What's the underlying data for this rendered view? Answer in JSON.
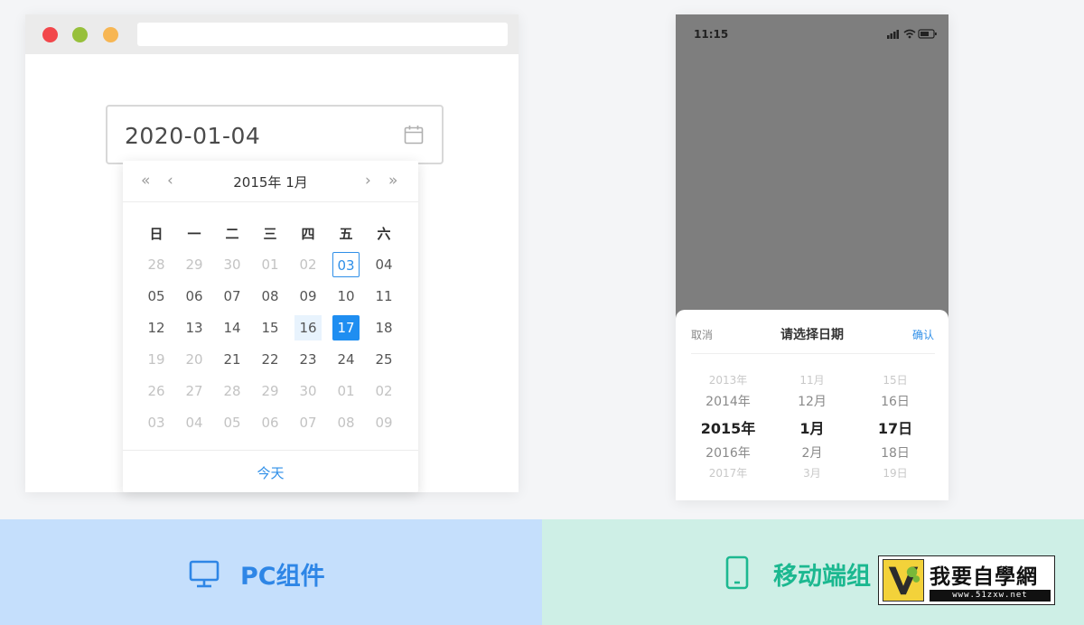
{
  "pc": {
    "date_input_value": "2020-01-04",
    "calendar": {
      "title": "2015年 1月",
      "nav": {
        "prev_year": "«",
        "prev_month": "‹",
        "next_month": "›",
        "next_year": "»"
      },
      "weekdays": [
        "日",
        "一",
        "二",
        "三",
        "四",
        "五",
        "六"
      ],
      "weeks": [
        [
          {
            "d": "28",
            "s": "muted"
          },
          {
            "d": "29",
            "s": "muted"
          },
          {
            "d": "30",
            "s": "muted"
          },
          {
            "d": "01",
            "s": "muted"
          },
          {
            "d": "02",
            "s": "muted"
          },
          {
            "d": "03",
            "s": "today"
          },
          {
            "d": "04",
            "s": ""
          }
        ],
        [
          {
            "d": "05",
            "s": ""
          },
          {
            "d": "06",
            "s": ""
          },
          {
            "d": "07",
            "s": ""
          },
          {
            "d": "08",
            "s": ""
          },
          {
            "d": "09",
            "s": ""
          },
          {
            "d": "10",
            "s": ""
          },
          {
            "d": "11",
            "s": ""
          }
        ],
        [
          {
            "d": "12",
            "s": ""
          },
          {
            "d": "13",
            "s": ""
          },
          {
            "d": "14",
            "s": ""
          },
          {
            "d": "15",
            "s": ""
          },
          {
            "d": "16",
            "s": "range"
          },
          {
            "d": "17",
            "s": "selected"
          },
          {
            "d": "18",
            "s": ""
          }
        ],
        [
          {
            "d": "19",
            "s": "muted"
          },
          {
            "d": "20",
            "s": "muted"
          },
          {
            "d": "21",
            "s": ""
          },
          {
            "d": "22",
            "s": ""
          },
          {
            "d": "23",
            "s": ""
          },
          {
            "d": "24",
            "s": ""
          },
          {
            "d": "25",
            "s": ""
          }
        ],
        [
          {
            "d": "26",
            "s": "muted"
          },
          {
            "d": "27",
            "s": "muted"
          },
          {
            "d": "28",
            "s": "muted"
          },
          {
            "d": "29",
            "s": "muted"
          },
          {
            "d": "30",
            "s": "muted"
          },
          {
            "d": "01",
            "s": "muted"
          },
          {
            "d": "02",
            "s": "muted"
          }
        ],
        [
          {
            "d": "03",
            "s": "muted"
          },
          {
            "d": "04",
            "s": "muted"
          },
          {
            "d": "05",
            "s": "muted"
          },
          {
            "d": "06",
            "s": "muted"
          },
          {
            "d": "07",
            "s": "muted"
          },
          {
            "d": "08",
            "s": "muted"
          },
          {
            "d": "09",
            "s": "muted"
          }
        ]
      ],
      "today_label": "今天"
    }
  },
  "mobile": {
    "status_time": "11:15",
    "status_icons": [
      "signal-icon",
      "wifi-icon",
      "battery-icon"
    ],
    "sheet": {
      "cancel": "取消",
      "title": "请选择日期",
      "confirm": "确认",
      "years": [
        "2013年",
        "2014年",
        "2015年",
        "2016年",
        "2017年"
      ],
      "months": [
        "11月",
        "12月",
        "1月",
        "2月",
        "3月"
      ],
      "days": [
        "15日",
        "16日",
        "17日",
        "18日",
        "19日"
      ]
    }
  },
  "banners": {
    "pc_label": "PC组件",
    "pc_icon": "monitor-icon",
    "mobile_label": "移动端组",
    "mobile_icon": "phone-icon"
  },
  "watermark": {
    "text": "我要自學網",
    "url": "www.51zxw.net"
  },
  "colors": {
    "accent_blue": "#1f8ef1",
    "mobile_green": "#1cb890",
    "pc_banner_bg": "#c5dffc",
    "mobile_banner_bg": "#ceefe6"
  }
}
